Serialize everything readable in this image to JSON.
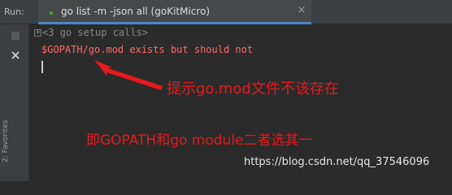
{
  "toolbar": {
    "run_label": "Run:"
  },
  "tab": {
    "title": "go list -m -json all (goKitMicro)",
    "close": "×"
  },
  "gutter": {
    "buttons": [
      "stop-icon",
      "close-icon"
    ],
    "favorites_label": "2: Favorites"
  },
  "console": {
    "fold_marker": "+",
    "folded_text": "<3 go setup calls>",
    "error_line": "$GOPATH/go.mod exists but should not"
  },
  "annotations": {
    "note1": "提示go.mod文件不该存在",
    "note2": "即GOPATH和go module二者选其一"
  },
  "watermark": "https://blog.csdn.net/qq_37546096",
  "colors": {
    "error": "#ff6b68",
    "annotation": "#e8191b",
    "tab_underline": "#4a88c7"
  }
}
